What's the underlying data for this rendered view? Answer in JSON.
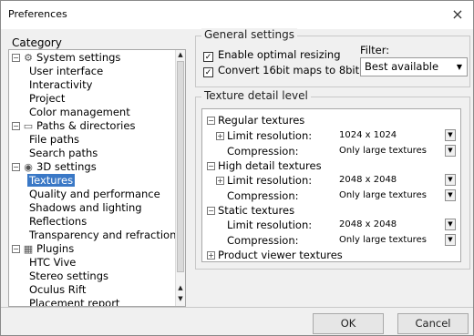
{
  "window": {
    "title": "Preferences",
    "close_glyph": "×"
  },
  "category": {
    "header": "Category",
    "items": [
      {
        "label": "System settings",
        "type": "group",
        "icon": "gear-icon",
        "icon_glyph": "⚙",
        "toggle": "−"
      },
      {
        "label": "User interface",
        "type": "child"
      },
      {
        "label": "Interactivity",
        "type": "child"
      },
      {
        "label": "Project",
        "type": "child"
      },
      {
        "label": "Color management",
        "type": "child"
      },
      {
        "label": "Paths & directories",
        "type": "group",
        "icon": "folder-icon",
        "icon_glyph": "▭",
        "toggle": "−"
      },
      {
        "label": "File paths",
        "type": "child"
      },
      {
        "label": "Search paths",
        "type": "child"
      },
      {
        "label": "3D settings",
        "type": "group",
        "icon": "cube-icon",
        "icon_glyph": "◉",
        "toggle": "−"
      },
      {
        "label": "Textures",
        "type": "child",
        "selected": true
      },
      {
        "label": "Quality and performance",
        "type": "child"
      },
      {
        "label": "Shadows and lighting",
        "type": "child"
      },
      {
        "label": "Reflections",
        "type": "child"
      },
      {
        "label": "Transparency and refraction",
        "type": "child"
      },
      {
        "label": "Plugins",
        "type": "group",
        "icon": "plugin-icon",
        "icon_glyph": "▦",
        "toggle": "−"
      },
      {
        "label": "HTC Vive",
        "type": "child"
      },
      {
        "label": "Stereo settings",
        "type": "child"
      },
      {
        "label": "Oculus Rift",
        "type": "child"
      },
      {
        "label": "Placement report",
        "type": "child"
      }
    ]
  },
  "general": {
    "title": "General settings",
    "checkbox_glyph": "✓",
    "enable_optimal_resizing": {
      "label": "Enable optimal resizing",
      "checked": true
    },
    "convert_16bit": {
      "label": "Convert 16bit maps to 8bit",
      "checked": true
    },
    "filter": {
      "label": "Filter:",
      "value": "Best available"
    }
  },
  "texture_detail": {
    "title": "Texture detail level",
    "groups": [
      {
        "name": "Regular textures",
        "toggle": "−",
        "limit_label": "Limit resolution:",
        "limit_toggle": "+",
        "limit_value": "1024 x 1024",
        "compression_label": "Compression:",
        "compression_value": "Only large textures"
      },
      {
        "name": "High detail textures",
        "toggle": "−",
        "limit_label": "Limit resolution:",
        "limit_toggle": "+",
        "limit_value": "2048 x 2048",
        "compression_label": "Compression:",
        "compression_value": "Only large textures"
      },
      {
        "name": "Static textures",
        "toggle": "−",
        "limit_label": "Limit resolution:",
        "limit_value": "2048 x 2048",
        "compression_label": "Compression:",
        "compression_value": "Only large textures"
      }
    ],
    "product_viewer": {
      "name": "Product viewer textures",
      "toggle": "+"
    }
  },
  "buttons": {
    "ok": "OK",
    "cancel": "Cancel"
  },
  "glyphs": {
    "dropdown": "▼",
    "scroll_up": "▲",
    "scroll_down": "▼",
    "dropdown_small": "▼"
  }
}
